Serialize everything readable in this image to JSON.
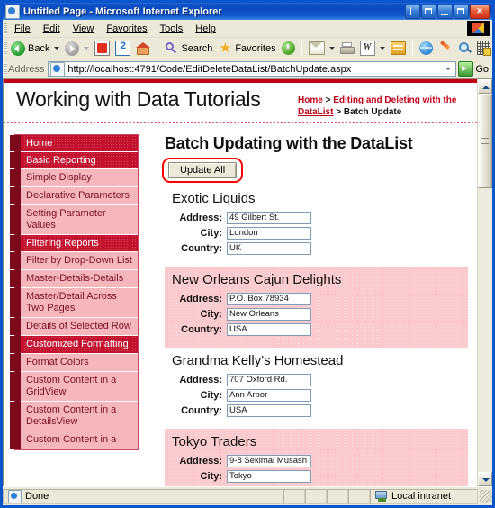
{
  "window": {
    "title": "Untitled Page - Microsoft Internet Explorer",
    "title_icon": "ie-page-icon",
    "buttons": {
      "restore_split": "restore-split-button",
      "restore_down": "restore-down-button",
      "minimize": "minimize-button",
      "maximize": "maximize-button",
      "close": "close-button"
    }
  },
  "menubar": {
    "items": [
      {
        "label": "File",
        "accel": "F"
      },
      {
        "label": "Edit",
        "accel": "E"
      },
      {
        "label": "View",
        "accel": "V"
      },
      {
        "label": "Favorites",
        "accel": "a"
      },
      {
        "label": "Tools",
        "accel": "T"
      },
      {
        "label": "Help",
        "accel": "H"
      }
    ]
  },
  "toolbar": {
    "back_label": "Back",
    "search_label": "Search",
    "favorites_label": "Favorites",
    "icons": [
      "back-icon",
      "forward-icon",
      "stop-icon",
      "refresh-icon",
      "home-icon",
      "search-icon",
      "favorites-star-icon",
      "history-icon",
      "mail-icon",
      "print-icon",
      "edit-word-icon",
      "messenger-icon",
      "globe-icon",
      "pen-icon",
      "discuss-icon",
      "grid-icon"
    ]
  },
  "address": {
    "label": "Address",
    "url": "http://localhost:4791/Code/EditDeleteDataList/BatchUpdate.aspx",
    "go_label": "Go"
  },
  "site": {
    "title": "Working with Data Tutorials"
  },
  "breadcrumb": {
    "home": "Home",
    "sep1": " > ",
    "parent": "Editing and Deleting with the DataList",
    "sep2": " > ",
    "current": "Batch Update"
  },
  "sidebar": {
    "items": [
      {
        "label": "Home",
        "type": "section"
      },
      {
        "label": "Basic Reporting",
        "type": "section"
      },
      {
        "label": "Simple Display",
        "type": "link"
      },
      {
        "label": "Declarative Parameters",
        "type": "link"
      },
      {
        "label": "Setting Parameter Values",
        "type": "link"
      },
      {
        "label": "Filtering Reports",
        "type": "section"
      },
      {
        "label": "Filter by Drop-Down List",
        "type": "link"
      },
      {
        "label": "Master-Details-Details",
        "type": "link"
      },
      {
        "label": "Master/Detail Across Two Pages",
        "type": "link"
      },
      {
        "label": "Details of Selected Row",
        "type": "link"
      },
      {
        "label": "Customized Formatting",
        "type": "section"
      },
      {
        "label": "Format Colors",
        "type": "link"
      },
      {
        "label": "Custom Content in a GridView",
        "type": "link"
      },
      {
        "label": "Custom Content in a DetailsView",
        "type": "link"
      },
      {
        "label": "Custom Content in a",
        "type": "link"
      }
    ]
  },
  "main": {
    "page_title": "Batch Updating with the DataList",
    "update_all_label": "Update All",
    "field_labels": {
      "address": "Address:",
      "city": "City:",
      "country": "Country:"
    },
    "records": [
      {
        "name": "Exotic Liquids",
        "address": "49 Gilbert St.",
        "city": "London",
        "country": "UK",
        "alt": false
      },
      {
        "name": "New Orleans Cajun Delights",
        "address": "P.O. Box 78934",
        "city": "New Orleans",
        "country": "USA",
        "alt": true
      },
      {
        "name": "Grandma Kelly's Homestead",
        "address": "707 Oxford Rd.",
        "city": "Ann Arbor",
        "country": "USA",
        "alt": false
      },
      {
        "name": "Tokyo Traders",
        "address": "9-8 Sekimai Musash",
        "city": "Tokyo",
        "country": "",
        "alt": true
      }
    ]
  },
  "statusbar": {
    "status": "Done",
    "zone": "Local intranet"
  },
  "colors": {
    "brand_red": "#c3112e",
    "dark_red": "#7a0a1c",
    "pink_link": "#f5b7bc",
    "alt_row": "#fbc9cc",
    "annotation": "#ff0000",
    "title_blue": "#0a50c8"
  }
}
